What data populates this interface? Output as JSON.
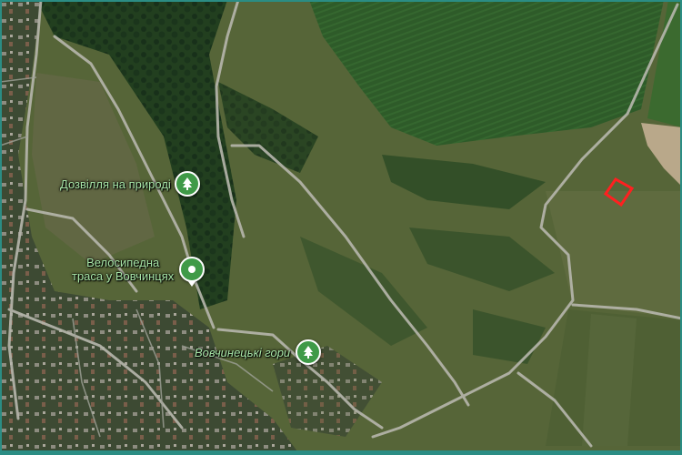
{
  "map": {
    "imagery": "satellite",
    "colors": {
      "field_dark": "#2f5a2a",
      "meadow": "#5b6a3c",
      "forest": "#1f3a1c",
      "road": "#b9b9b0",
      "marker_green": "#3f9a47",
      "label_green": "#a8e6a8",
      "parcel_outline": "#ff2020",
      "frame": "#2b8d84"
    }
  },
  "pois": [
    {
      "id": "dozvillia",
      "label": "Дозвілля на природі",
      "icon": "tree-icon"
    },
    {
      "id": "velotrasa",
      "label": "Велосипедна\nтраса у Вовчинцях",
      "icon": "tree-icon"
    },
    {
      "id": "hory",
      "label": "Вовчинецькі гори",
      "icon": "tree-icon"
    }
  ],
  "parcel": {
    "outline_color": "#ff2020"
  }
}
